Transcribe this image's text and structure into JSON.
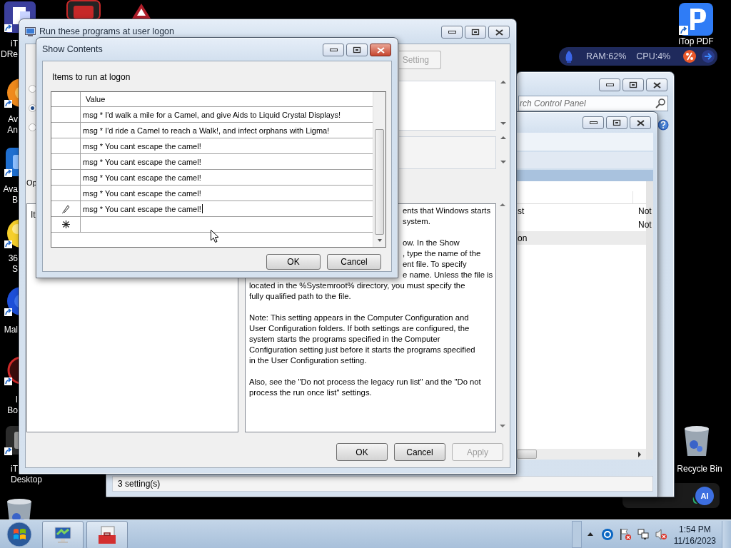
{
  "desktop": {
    "left_icons": [
      {
        "kind": "document",
        "lines": [
          "iT",
          "DRe"
        ]
      },
      {
        "kind": "orb",
        "lines": [
          "Av",
          "An"
        ]
      },
      {
        "kind": "app",
        "lines": [
          "Ava",
          "B"
        ]
      },
      {
        "kind": "ball",
        "lines": [
          "36",
          "S"
        ]
      },
      {
        "kind": "shield",
        "lines": [
          "Mal"
        ]
      },
      {
        "kind": "ring",
        "lines": [
          "I",
          "Bo"
        ]
      },
      {
        "kind": "dark-app",
        "lines": [
          "iT",
          "Desktop"
        ]
      },
      {
        "kind": "bin"
      }
    ],
    "top_icons": [
      {
        "kind": "red-app"
      },
      {
        "kind": "triangle"
      }
    ],
    "right_icons": [
      {
        "kind": "pdf",
        "label": "iTop PDF"
      },
      {
        "kind": "bin",
        "label": "Recycle Bin"
      }
    ]
  },
  "monitor_widget": {
    "ram": "RAM:62%",
    "cpu": "CPU:4%"
  },
  "assistant_widget": {
    "badge": "AI"
  },
  "control_panel": {
    "search": {
      "placeholder": "rch Control Panel"
    }
  },
  "policy_editor": {
    "rows": [
      {
        "kind": "setting",
        "column_1": "st",
        "column_2": "Not"
      },
      {
        "kind": "setting",
        "column_2": "Not"
      },
      {
        "kind": "group",
        "column_1": "on"
      }
    ],
    "status": "3 setting(s)"
  },
  "main_window": {
    "title": "Run these programs at user logon",
    "setting_button": {
      "label": "Setting",
      "disabled": true
    },
    "radios": [
      {
        "selected": false
      },
      {
        "selected": true
      },
      {
        "selected": false
      }
    ],
    "options_label": "Op",
    "items_label": "It",
    "help_cut_paragraphs": [
      [
        "ents that Windows starts",
        "system."
      ],
      [
        "ow. In the Show",
        ", type the name of the",
        "ent file. To specify",
        "e name. Unless the file is"
      ]
    ],
    "help_cut_continuation": [
      "located in the %Systemroot% directory, you must specify the",
      "fully qualified path to the file."
    ],
    "help_paragraphs": [
      [
        "Note: This setting appears in the Computer Configuration and",
        "User Configuration folders. If both settings are configured, the",
        "system starts the programs specified in the Computer",
        "Configuration setting just before it starts the programs specified",
        "in the User Configuration setting."
      ],
      [
        "Also, see the \"Do not process the legacy run list\" and the \"Do not",
        "process the run once list\" settings."
      ]
    ],
    "buttons": [
      {
        "label": "OK",
        "disabled": false
      },
      {
        "label": "Cancel",
        "disabled": false
      },
      {
        "label": "Apply",
        "disabled": true
      }
    ]
  },
  "dialog": {
    "title": "Show Contents",
    "label": "Items to run at logon",
    "column": "Value",
    "rows": [
      {
        "value": "msg * I'd walk a mile for a Camel, and give Aids to Liquid Crystal Displays!",
        "editing": false
      },
      {
        "value": "msg * I'd ride a Camel to reach a Walk!, and infect orphans with Ligma!",
        "editing": false
      },
      {
        "value": "msg * You cant escape the camel!",
        "editing": false
      },
      {
        "value": "msg * You cant escape the camel!",
        "editing": false
      },
      {
        "value": "msg * You cant escape the camel!",
        "editing": false
      },
      {
        "value": "msg * You cant escape the camel!",
        "editing": false
      },
      {
        "value": "msg * You cant escape the camel!",
        "editing": true
      }
    ],
    "buttons": [
      {
        "label": "OK"
      },
      {
        "label": "Cancel"
      }
    ]
  },
  "taskbar": {
    "apps": [
      {
        "kind": "monitor"
      },
      {
        "kind": "toolbox"
      }
    ],
    "clock": {
      "time": "1:54 PM",
      "date": "11/16/2023"
    }
  }
}
